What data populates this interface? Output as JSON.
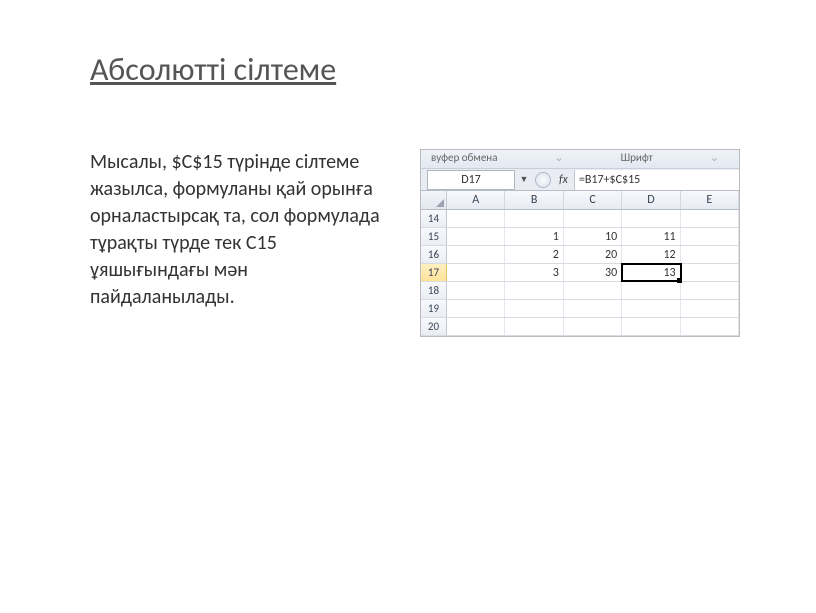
{
  "title": "Абсолютті сілтеме",
  "body_text": "Мысалы, $С$15 түрінде сілтеме жазылса, формуланы қай орынға орналастырсақ та, сол формулада тұрақты түрде тек С15 ұяшығындағы мән пайдаланылады.",
  "excel": {
    "ribbon_left": "вуфер обмена",
    "ribbon_right": "Шрифт",
    "namebox": "D17",
    "fx": "fx",
    "formula": "=B17+$C$15",
    "columns": [
      "A",
      "B",
      "C",
      "D",
      "E"
    ],
    "rows": [
      {
        "n": "14",
        "cells": [
          "",
          "",
          "",
          "",
          ""
        ]
      },
      {
        "n": "15",
        "cells": [
          "",
          "1",
          "10",
          "11",
          ""
        ]
      },
      {
        "n": "16",
        "cells": [
          "",
          "2",
          "20",
          "12",
          ""
        ]
      },
      {
        "n": "17",
        "cells": [
          "",
          "3",
          "30",
          "13",
          ""
        ],
        "active_col": 3,
        "selected": true
      },
      {
        "n": "18",
        "cells": [
          "",
          "",
          "",
          "",
          ""
        ]
      },
      {
        "n": "19",
        "cells": [
          "",
          "",
          "",
          "",
          ""
        ]
      },
      {
        "n": "20",
        "cells": [
          "",
          "",
          "",
          "",
          ""
        ]
      }
    ]
  }
}
